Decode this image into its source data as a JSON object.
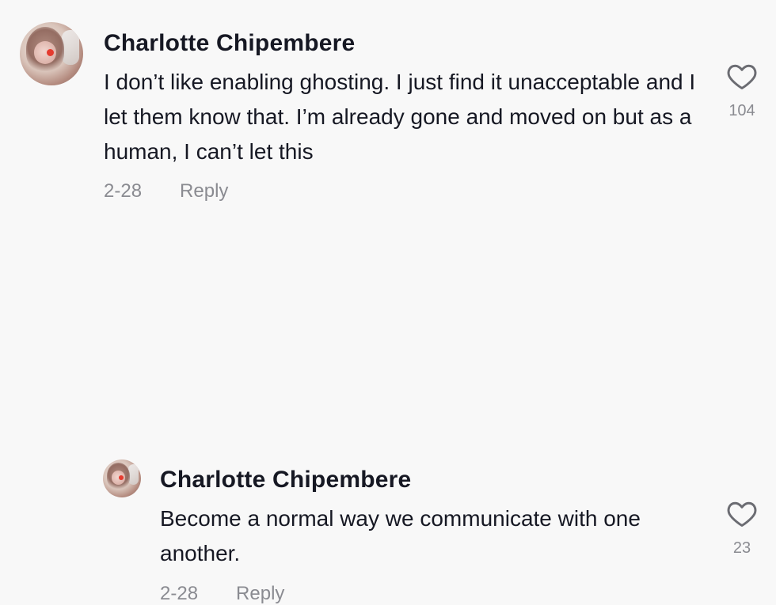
{
  "comments": [
    {
      "username": "Charlotte Chipembere",
      "text": "I don’t like enabling ghosting. I just find it unacceptable and I let them know that. I’m already gone and moved on but as a human, I can’t let this",
      "date": "2-28",
      "reply_label": "Reply",
      "likes": "104"
    },
    {
      "username": "Charlotte Chipembere",
      "text": "Become a normal way we communicate with one another.",
      "date": "2-28",
      "reply_label": "Reply",
      "likes": "23"
    }
  ],
  "colors": {
    "background": "#f8f8f8",
    "username": "#161823",
    "meta": "#8a8b91"
  },
  "icons": {
    "like": "heart-outline-icon"
  }
}
